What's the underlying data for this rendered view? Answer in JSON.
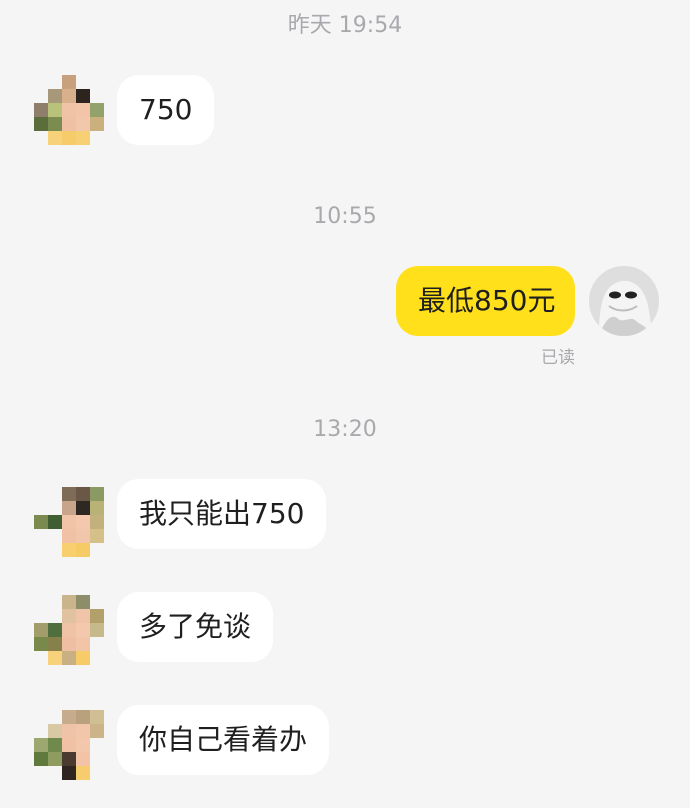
{
  "timestamps": [
    "昨天 19:54",
    "10:55",
    "13:20"
  ],
  "messages": [
    {
      "from": "other",
      "text": "750"
    },
    {
      "from": "me",
      "text": "最低850元",
      "status": "已读"
    },
    {
      "from": "other",
      "text": "我只能出750"
    },
    {
      "from": "other",
      "text": "多了免谈"
    },
    {
      "from": "other",
      "text": "你自己看着办"
    }
  ],
  "colors": {
    "background": "#f5f5f6",
    "incoming_bubble": "#ffffff",
    "outgoing_bubble": "#ffe01a",
    "timestamp_text": "#a9a9ad"
  },
  "icons": [
    "pixelated-avatar-icon",
    "ghost-avatar-icon"
  ]
}
